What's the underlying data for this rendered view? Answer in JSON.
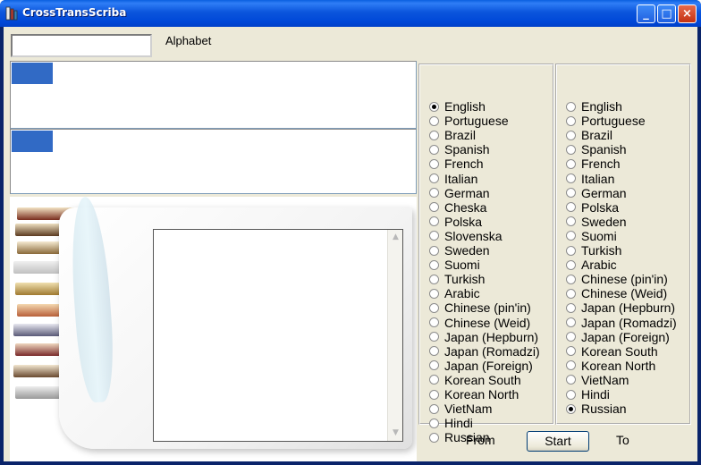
{
  "window": {
    "title": "CrossTransScriba",
    "minimize_glyph": "_",
    "maximize_glyph": "□",
    "close_glyph": "×"
  },
  "alphabet": {
    "input_value": "",
    "label": "Alphabet"
  },
  "from_languages": [
    {
      "label": "English",
      "selected": true
    },
    {
      "label": "Portuguese",
      "selected": false
    },
    {
      "label": "Brazil",
      "selected": false
    },
    {
      "label": "Spanish",
      "selected": false
    },
    {
      "label": "French",
      "selected": false
    },
    {
      "label": "Italian",
      "selected": false
    },
    {
      "label": "German",
      "selected": false
    },
    {
      "label": "Cheska",
      "selected": false
    },
    {
      "label": "Polska",
      "selected": false
    },
    {
      "label": "Slovenska",
      "selected": false
    },
    {
      "label": "Sweden",
      "selected": false
    },
    {
      "label": "Suomi",
      "selected": false
    },
    {
      "label": "Turkish",
      "selected": false
    },
    {
      "label": "Arabic",
      "selected": false
    },
    {
      "label": "Chinese (pin'in)",
      "selected": false
    },
    {
      "label": "Chinese (Weid)",
      "selected": false
    },
    {
      "label": "Japan (Hepburn)",
      "selected": false
    },
    {
      "label": "Japan (Romadzi)",
      "selected": false
    },
    {
      "label": "Japan (Foreign)",
      "selected": false
    },
    {
      "label": "Korean South",
      "selected": false
    },
    {
      "label": "Korean North",
      "selected": false
    },
    {
      "label": "VietNam",
      "selected": false
    },
    {
      "label": "Hindi",
      "selected": false
    },
    {
      "label": "Russian",
      "selected": false
    }
  ],
  "to_languages": [
    {
      "label": "English",
      "selected": false
    },
    {
      "label": "Portuguese",
      "selected": false
    },
    {
      "label": "Brazil",
      "selected": false
    },
    {
      "label": "Spanish",
      "selected": false
    },
    {
      "label": "French",
      "selected": false
    },
    {
      "label": "Italian",
      "selected": false
    },
    {
      "label": "German",
      "selected": false
    },
    {
      "label": "Polska",
      "selected": false
    },
    {
      "label": "Sweden",
      "selected": false
    },
    {
      "label": "Suomi",
      "selected": false
    },
    {
      "label": "Turkish",
      "selected": false
    },
    {
      "label": "Arabic",
      "selected": false
    },
    {
      "label": "Chinese (pin'in)",
      "selected": false
    },
    {
      "label": "Chinese (Weid)",
      "selected": false
    },
    {
      "label": "Japan (Hepburn)",
      "selected": false
    },
    {
      "label": "Japan (Romadzi)",
      "selected": false
    },
    {
      "label": "Japan (Foreign)",
      "selected": false
    },
    {
      "label": "Korean South",
      "selected": false
    },
    {
      "label": "Korean North",
      "selected": false
    },
    {
      "label": "VietNam",
      "selected": false
    },
    {
      "label": "Hindi",
      "selected": false
    },
    {
      "label": "Russian",
      "selected": true
    }
  ],
  "bottom": {
    "from_label": "From",
    "start_button": "Start",
    "to_label": "To"
  },
  "colors": {
    "selection": "#316ac5",
    "titlebar": "#0054e3",
    "face": "#ece9d8"
  }
}
